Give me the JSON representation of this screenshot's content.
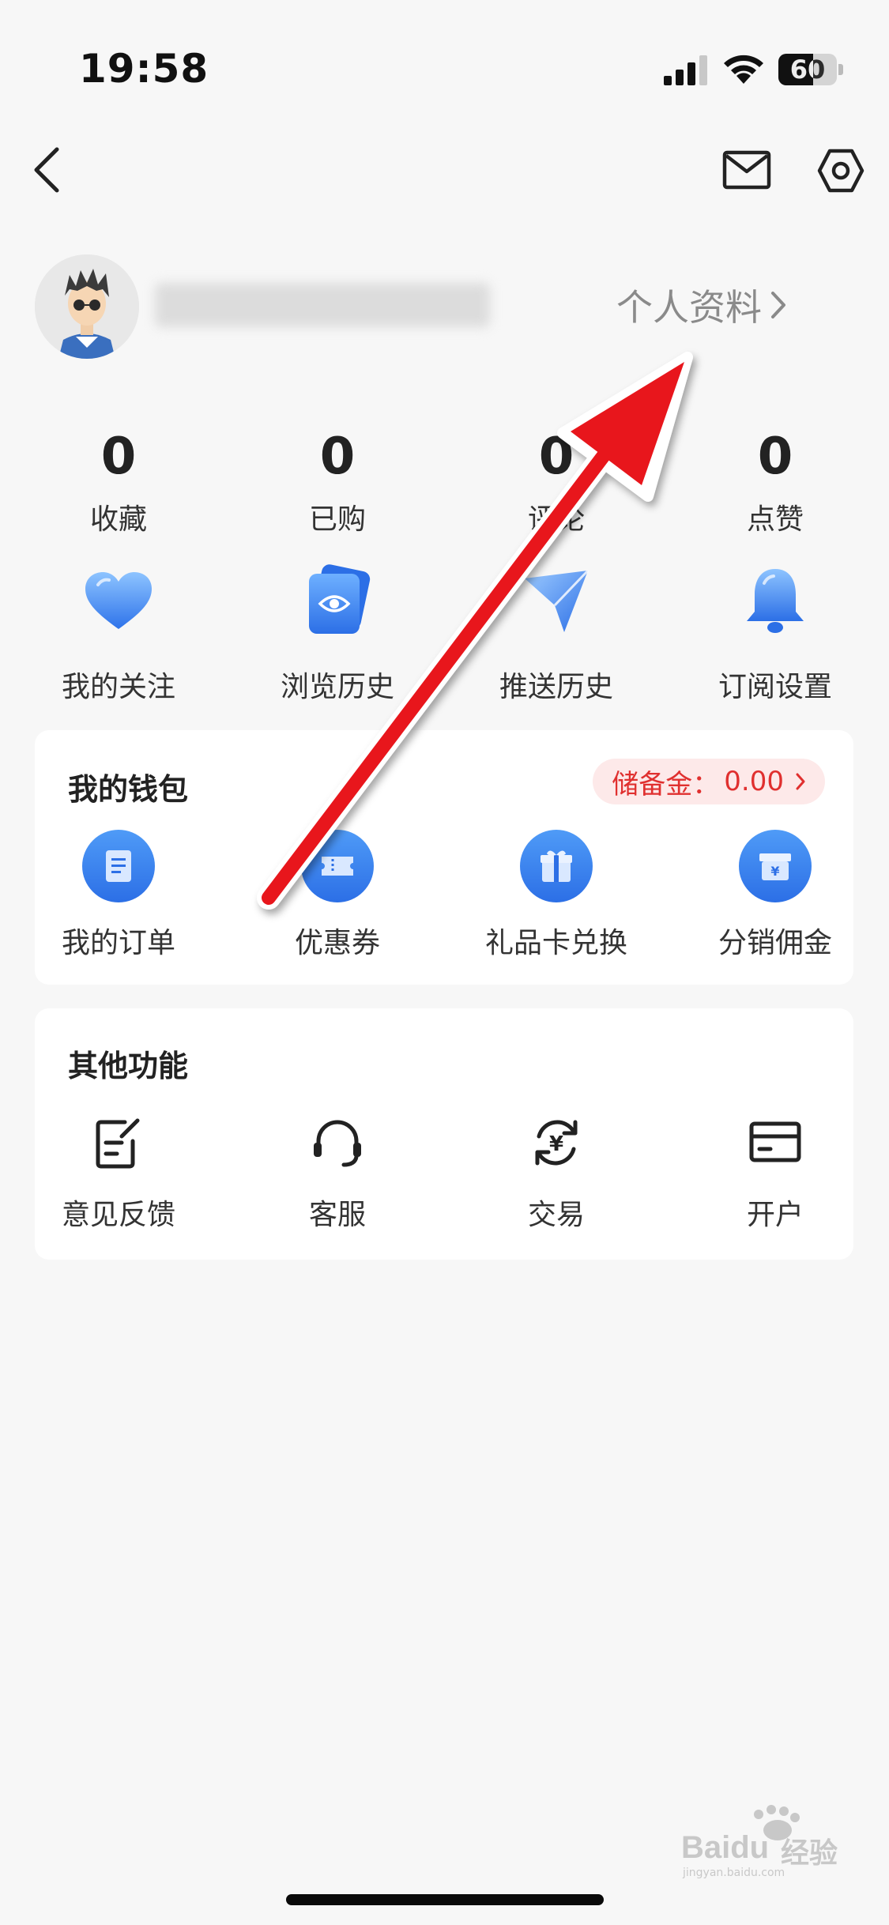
{
  "status_bar": {
    "time": "19:58",
    "battery_level": "60",
    "battery_fraction": 0.6
  },
  "header": {
    "back_icon": "chevron-left-icon",
    "mail_icon": "mail-icon",
    "settings_icon": "hexagon-settings-icon"
  },
  "profile": {
    "link_label": "个人资料"
  },
  "stats": [
    {
      "value": "0",
      "label": "收藏"
    },
    {
      "value": "0",
      "label": "已购"
    },
    {
      "value": "0",
      "label": "评论"
    },
    {
      "value": "0",
      "label": "点赞"
    }
  ],
  "features": [
    {
      "label": "我的关注",
      "icon": "heart-icon"
    },
    {
      "label": "浏览历史",
      "icon": "eye-card-icon"
    },
    {
      "label": "推送历史",
      "icon": "paper-plane-icon"
    },
    {
      "label": "订阅设置",
      "icon": "bell-icon"
    }
  ],
  "wallet": {
    "title": "我的钱包",
    "reserve_label": "储备金：",
    "reserve_value": "0.00",
    "items": [
      {
        "label": "我的订单",
        "icon": "order-document-icon"
      },
      {
        "label": "优惠券",
        "icon": "coupon-icon"
      },
      {
        "label": "礼品卡兑换",
        "icon": "gift-box-icon"
      },
      {
        "label": "分销佣金",
        "icon": "yuan-box-icon"
      }
    ]
  },
  "other": {
    "title": "其他功能",
    "items": [
      {
        "label": "意见反馈",
        "icon": "feedback-edit-icon"
      },
      {
        "label": "客服",
        "icon": "headset-icon"
      },
      {
        "label": "交易",
        "icon": "yuan-exchange-icon"
      },
      {
        "label": "开户",
        "icon": "card-icon"
      }
    ]
  },
  "watermark": {
    "brand": "Baidu",
    "text": "经验",
    "url": "jingyan.baidu.com"
  },
  "colors": {
    "background": "#f7f7f7",
    "accent_blue": "#2c6fe6",
    "reserve_red": "#e0302f",
    "annotation_arrow": "#e8141c"
  }
}
